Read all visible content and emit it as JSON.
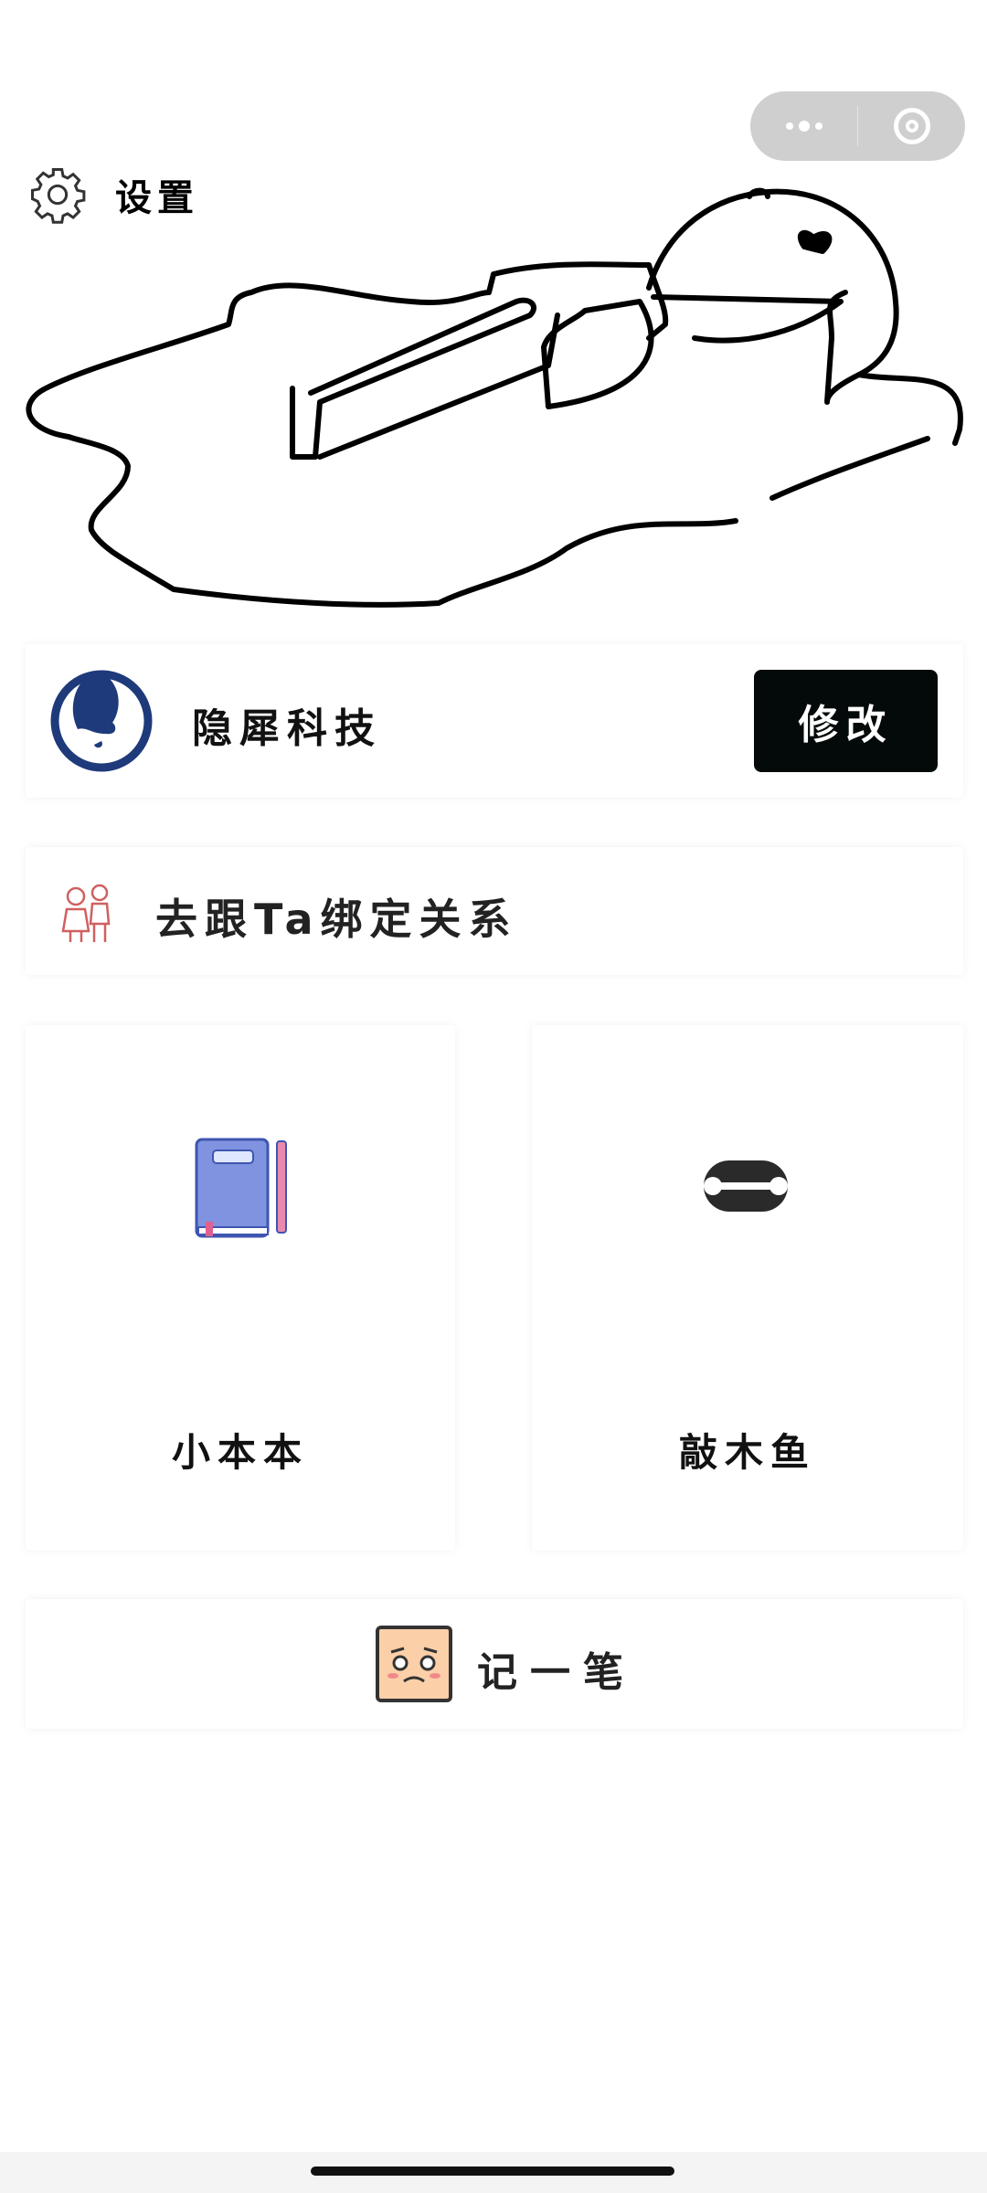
{
  "capsule": {
    "more_icon": "more-dots-icon",
    "close_icon": "target-circle-icon"
  },
  "header": {
    "settings_label": "设置",
    "settings_icon": "gear-icon"
  },
  "profile": {
    "name": "隐犀科技",
    "edit_label": "修改",
    "logo_color": "#1e3a7a",
    "button_color": "#040a0a"
  },
  "bind": {
    "label": "去跟Ta绑定关系",
    "icon": "couple-icon"
  },
  "tiles": [
    {
      "label": "小本本",
      "icon": "notebook-icon"
    },
    {
      "label": "敲木鱼",
      "icon": "wooden-fish-icon"
    }
  ],
  "note": {
    "label": "记一笔",
    "icon": "crying-face-icon"
  }
}
